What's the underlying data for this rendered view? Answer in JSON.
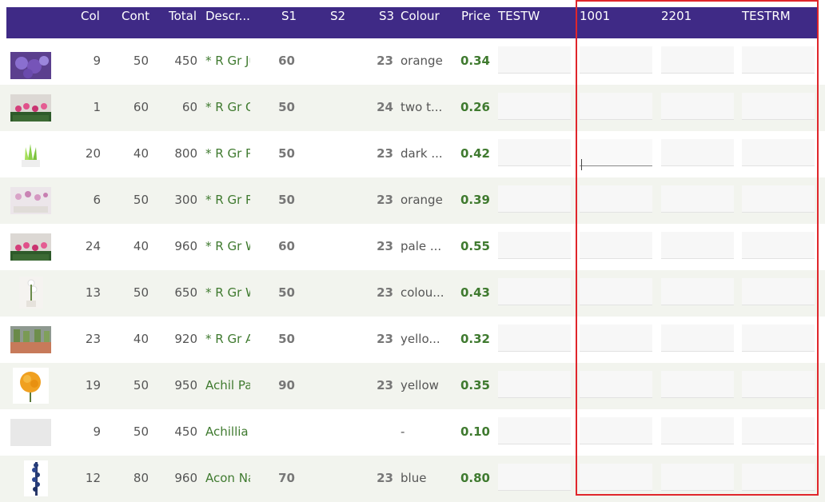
{
  "header": {
    "col": "Col",
    "cont": "Cont",
    "total": "Total",
    "descr": "Descr...",
    "s1": "S1",
    "s2": "S2",
    "s3": "S3",
    "colour": "Colour",
    "price": "Price",
    "testw": "TESTW",
    "c1001": "1001",
    "c2201": "2201",
    "testrm": "TESTRM"
  },
  "colors": {
    "header_bg": "#3f2a86",
    "accent_green": "#3f7a2f",
    "highlight_red": "#e0262b",
    "alt_row": "#f2f4ee"
  },
  "rows": [
    {
      "col": "9",
      "cont": "50",
      "total": "450",
      "descr": "* R Gr Ju",
      "s1": "60",
      "s2": "",
      "s3": "23",
      "colour": "orange",
      "price": "0.34",
      "thumb": "purple-flower"
    },
    {
      "col": "1",
      "cont": "60",
      "total": "60",
      "descr": "* R Gr O",
      "s1": "50",
      "s2": "",
      "s3": "24",
      "colour": "two t...",
      "price": "0.26",
      "thumb": "pink-potted-plant"
    },
    {
      "col": "20",
      "cont": "40",
      "total": "800",
      "descr": "* R Gr Po",
      "s1": "50",
      "s2": "",
      "s3": "23",
      "colour": "dark ...",
      "price": "0.42",
      "thumb": "green-plant"
    },
    {
      "col": "6",
      "cont": "50",
      "total": "300",
      "descr": "* R Gr Ro",
      "s1": "50",
      "s2": "",
      "s3": "23",
      "colour": "orange",
      "price": "0.39",
      "thumb": "pink-orchids"
    },
    {
      "col": "24",
      "cont": "40",
      "total": "960",
      "descr": "* R Gr W",
      "s1": "60",
      "s2": "",
      "s3": "23",
      "colour": "pale ...",
      "price": "0.55",
      "thumb": "pink-potted-plant"
    },
    {
      "col": "13",
      "cont": "50",
      "total": "650",
      "descr": "* R Gr W",
      "s1": "50",
      "s2": "",
      "s3": "23",
      "colour": "colou...",
      "price": "0.43",
      "thumb": "white-orchid"
    },
    {
      "col": "23",
      "cont": "40",
      "total": "920",
      "descr": "* R Gr Æ",
      "s1": "50",
      "s2": "",
      "s3": "23",
      "colour": "yello...",
      "price": "0.32",
      "thumb": "yellow-pink-bunches"
    },
    {
      "col": "19",
      "cont": "50",
      "total": "950",
      "descr": "Achil Pa",
      "s1": "90",
      "s2": "",
      "s3": "23",
      "colour": "yellow",
      "price": "0.35",
      "thumb": "yellow-flower"
    },
    {
      "col": "9",
      "cont": "50",
      "total": "450",
      "descr": "Achillia",
      "s1": "",
      "s2": "",
      "s3": "",
      "colour": "-",
      "price": "0.10",
      "thumb": "placeholder"
    },
    {
      "col": "12",
      "cont": "80",
      "total": "960",
      "descr": "Acon Na",
      "s1": "70",
      "s2": "",
      "s3": "23",
      "colour": "blue",
      "price": "0.80",
      "thumb": "blue-spike-flower"
    }
  ],
  "inputs": {
    "testw": "",
    "c1001": "",
    "c2201": "",
    "testrm": ""
  }
}
